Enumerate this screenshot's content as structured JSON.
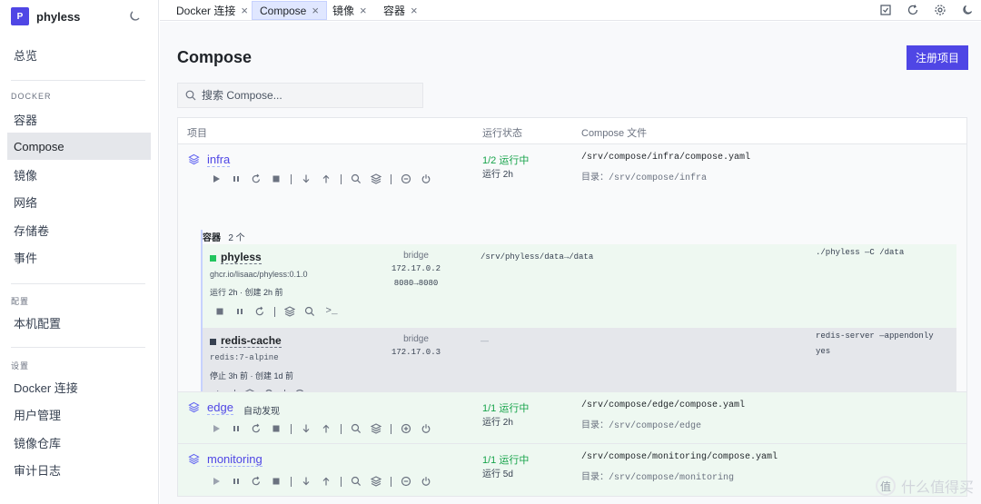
{
  "app": {
    "logo_letter": "P",
    "name": "phyless"
  },
  "sidebar": {
    "overview": "总览",
    "sections": {
      "docker": "DOCKER",
      "config": "配置",
      "settings": "设置"
    },
    "items": {
      "containers": "容器",
      "compose": "Compose",
      "images": "镜像",
      "networks": "网络",
      "volumes": "存储卷",
      "events": "事件",
      "local_config": "本机配置",
      "docker_conn": "Docker 连接",
      "users": "用户管理",
      "registry": "镜像仓库",
      "audit": "审计日志"
    }
  },
  "tabs": [
    {
      "label": "Docker 连接"
    },
    {
      "label": "Compose"
    },
    {
      "label": "镜像"
    },
    {
      "label": "容器"
    }
  ],
  "tab_close_glyph": "×",
  "page": {
    "title": "Compose",
    "register_button": "注册项目",
    "search_placeholder": "搜索 Compose..."
  },
  "table": {
    "headers": {
      "project": "项目",
      "status": "运行状态",
      "file": "Compose 文件"
    },
    "projects": [
      {
        "name": "infra",
        "status": "1/2 运行中",
        "uptime": "运行 2h",
        "file": "/srv/compose/infra/compose.yaml",
        "dir": "目录：/srv/compose/infra"
      },
      {
        "name": "edge",
        "badge": "自动发现",
        "status": "1/1 运行中",
        "uptime": "运行 2h",
        "file": "/srv/compose/edge/compose.yaml",
        "dir": "目录：/srv/compose/edge"
      },
      {
        "name": "monitoring",
        "status": "1/1 运行中",
        "uptime": "运行 5d",
        "file": "/srv/compose/monitoring/compose.yaml",
        "dir": "目录：/srv/compose/monitoring"
      }
    ],
    "containers_label": "容器",
    "containers_count": "2 个",
    "containers": [
      {
        "name": "phyless",
        "image": "ghcr.io/lisaac/phyless:0.1.0",
        "meta": "运行 2h · 创建 2h 前",
        "network": "bridge",
        "ip": "172.17.0.2",
        "ports": "8080→8080",
        "volume": "/srv/phyless/data→/data",
        "command": "./phyless —C /data",
        "state_color": "#22c55e"
      },
      {
        "name": "redis-cache",
        "image": "redis:7-alpine",
        "meta": "停止 3h 前 · 创建 1d 前",
        "network": "bridge",
        "ip": "172.17.0.3",
        "ports": "",
        "volume": "—",
        "command": "redis-server —appendonly yes",
        "state_color": "#374151"
      }
    ],
    "terminal_glyph": ">_"
  },
  "colors": {
    "accent": "#4f46e5",
    "running": "#16a34a",
    "running_bg": "#eef8f1",
    "stopped_bg": "#e5e7eb"
  },
  "watermark": "什么值得买"
}
